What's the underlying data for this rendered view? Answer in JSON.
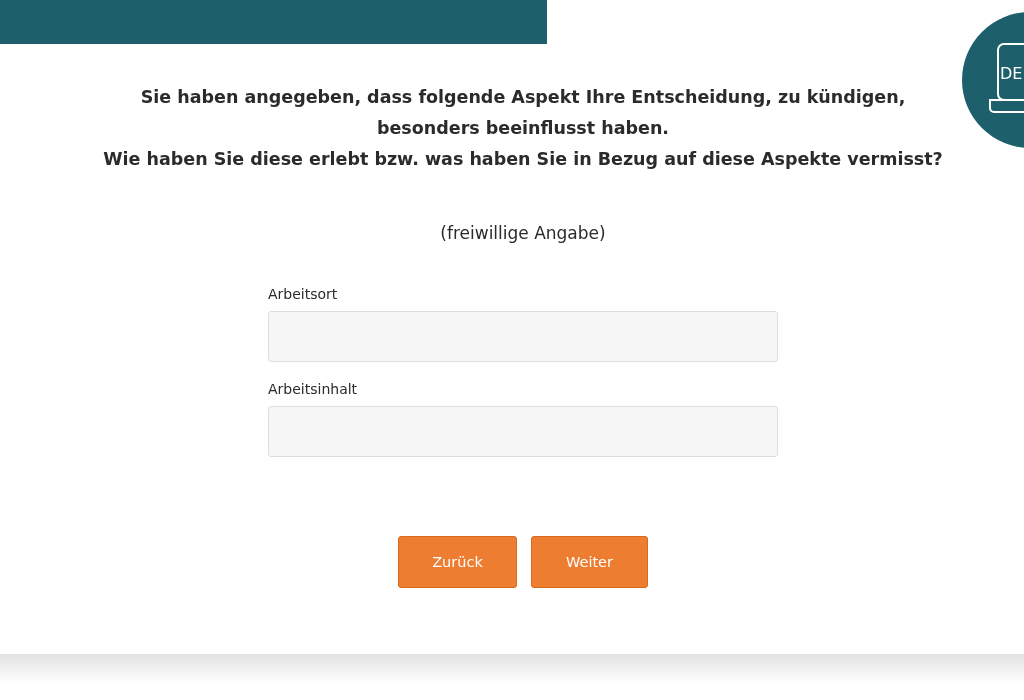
{
  "language_badge": {
    "label": "DE"
  },
  "heading_lines": [
    "Sie haben angegeben, dass folgende Aspekt Ihre Entscheidung, zu kündigen,",
    "besonders beeinflusst haben.",
    "Wie haben Sie diese erlebt bzw. was haben Sie in Bezug auf diese Aspekte vermisst?"
  ],
  "note": "(freiwillige Angabe)",
  "fields": [
    {
      "label": "Arbeitsort"
    },
    {
      "label": "Arbeitsinhalt"
    }
  ],
  "buttons": [
    {
      "label": "Zurück"
    },
    {
      "label": "Weiter"
    }
  ]
}
